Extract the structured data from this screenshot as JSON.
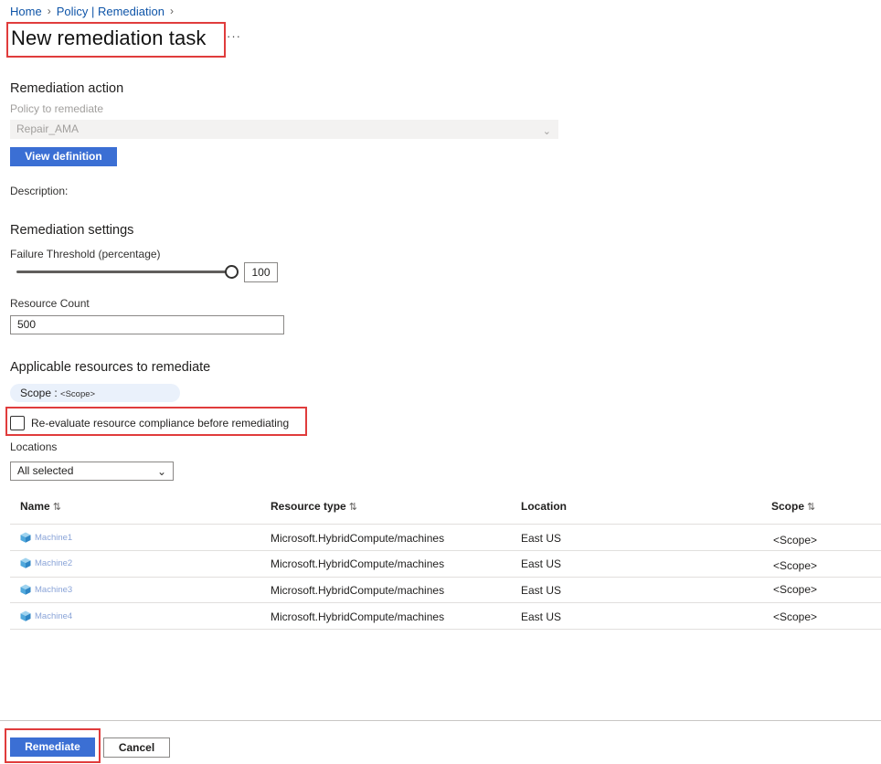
{
  "breadcrumb": {
    "home": "Home",
    "sep": ">",
    "policy": "Policy | Remediation"
  },
  "page": {
    "title": "New remediation task",
    "more": "···"
  },
  "remediation_action": {
    "heading": "Remediation action",
    "policy_label": "Policy to remediate",
    "policy_value": "Repair_AMA",
    "view_definition": "View definition",
    "description_label": "Description:"
  },
  "settings": {
    "heading": "Remediation settings",
    "threshold_label": "Failure Threshold (percentage)",
    "threshold_value": "100",
    "threshold_fraction": 1.0,
    "resource_count_label": "Resource Count",
    "resource_count_value": "500"
  },
  "applicable": {
    "heading": "Applicable resources to remediate",
    "scope_label": "Scope :",
    "scope_value": "<Scope>",
    "reevaluate_label": "Re-evaluate resource compliance before remediating",
    "locations_label": "Locations",
    "locations_value": "All selected"
  },
  "table": {
    "columns": [
      "Name",
      "Resource type",
      "Location",
      "Scope"
    ],
    "rows": [
      {
        "name": "Machine1",
        "type": "Microsoft.HybridCompute/machines",
        "location": "East US",
        "scope": "<Scope>"
      },
      {
        "name": "Machine2",
        "type": "Microsoft.HybridCompute/machines",
        "location": "East US",
        "scope": "<Scope>"
      },
      {
        "name": "Machine3",
        "type": "Microsoft.HybridCompute/machines",
        "location": "East US",
        "scope": "<Scope>"
      },
      {
        "name": "Machine4",
        "type": "Microsoft.HybridCompute/machines",
        "location": "East US",
        "scope": "<Scope>"
      }
    ]
  },
  "footer": {
    "remediate": "Remediate",
    "cancel": "Cancel"
  },
  "colors": {
    "accent": "#3b6fd4",
    "highlight": "#e03c3c",
    "link": "#0f55a8"
  },
  "icons": {
    "chevron": "chevron-down-icon",
    "sort": "sort-icon",
    "resource": "machine-cube-icon"
  }
}
